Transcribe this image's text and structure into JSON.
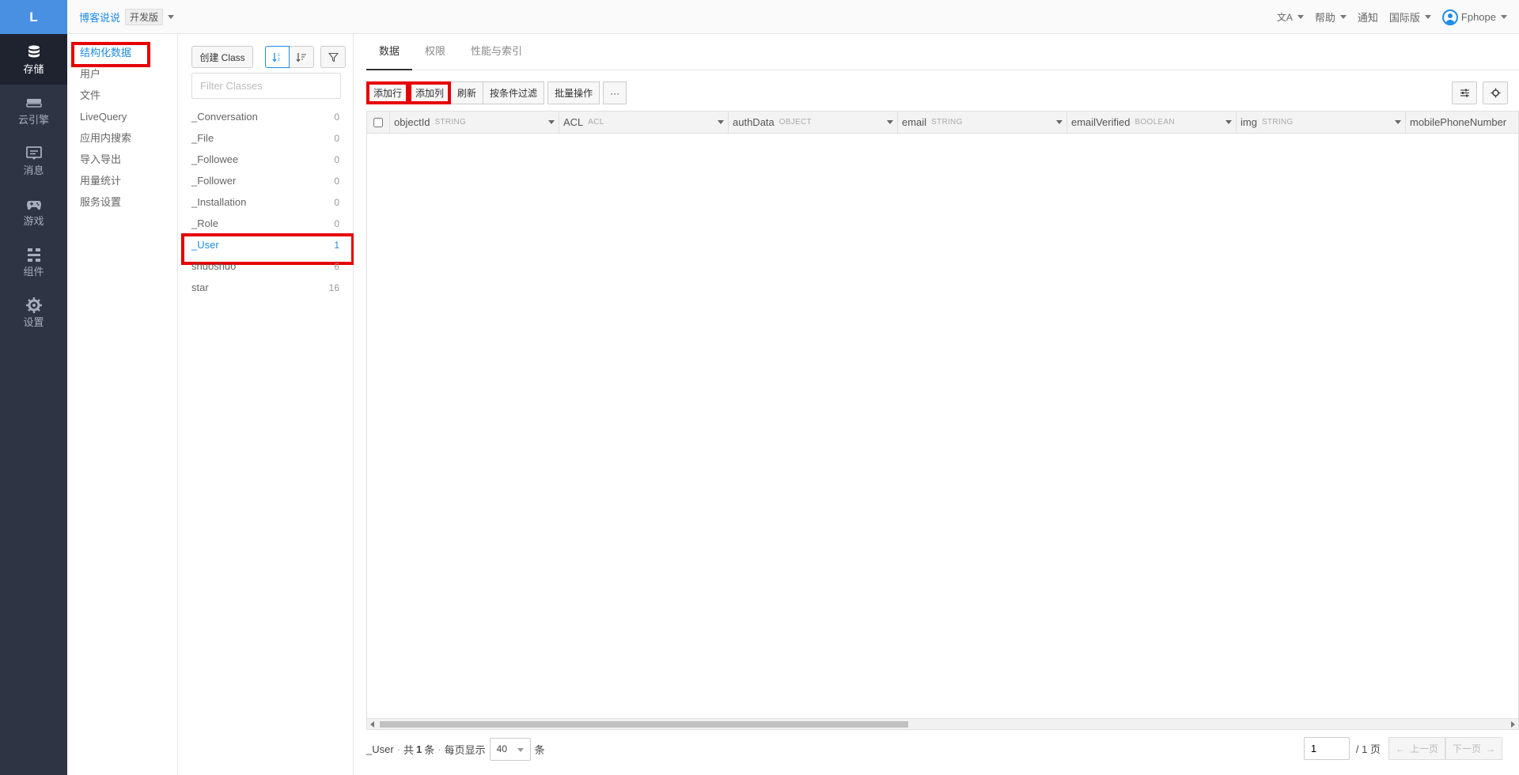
{
  "nav": {
    "logo": "L",
    "items": [
      {
        "label": "存储",
        "icon": "database-icon",
        "active": true
      },
      {
        "label": "云引擎",
        "icon": "server-icon",
        "active": false
      },
      {
        "label": "消息",
        "icon": "message-icon",
        "active": false
      },
      {
        "label": "游戏",
        "icon": "gamepad-icon",
        "active": false
      },
      {
        "label": "组件",
        "icon": "components-icon",
        "active": false
      },
      {
        "label": "设置",
        "icon": "gear-icon",
        "active": false
      }
    ]
  },
  "topbar": {
    "app_name": "博客说说",
    "env": "开发版",
    "translate_icon": "文A",
    "help": "帮助",
    "notify": "通知",
    "region": "国际版",
    "user": "Fphope"
  },
  "submenu": {
    "items": [
      "结构化数据",
      "用户",
      "文件",
      "LiveQuery",
      "应用内搜索",
      "导入导出",
      "用量统计",
      "服务设置"
    ]
  },
  "classes": {
    "create_label": "创建 Class",
    "filter_placeholder": "Filter Classes",
    "items": [
      {
        "name": "_Conversation",
        "count": "0"
      },
      {
        "name": "_File",
        "count": "0"
      },
      {
        "name": "_Followee",
        "count": "0"
      },
      {
        "name": "_Follower",
        "count": "0"
      },
      {
        "name": "_Installation",
        "count": "0"
      },
      {
        "name": "_Role",
        "count": "0"
      },
      {
        "name": "_User",
        "count": "1"
      },
      {
        "name": "shuoshuo",
        "count": "6"
      },
      {
        "name": "star",
        "count": "16"
      }
    ]
  },
  "tabs": [
    "数据",
    "权限",
    "性能与索引"
  ],
  "toolbar": {
    "add_row": "添加行",
    "add_col": "添加列",
    "refresh": "刷新",
    "filter": "按条件过滤",
    "batch": "批量操作",
    "more": "···"
  },
  "columns": [
    {
      "name": "objectId",
      "type": "STRING"
    },
    {
      "name": "ACL",
      "type": "ACL"
    },
    {
      "name": "authData",
      "type": "OBJECT"
    },
    {
      "name": "email",
      "type": "STRING"
    },
    {
      "name": "emailVerified",
      "type": "BOOLEAN"
    },
    {
      "name": "img",
      "type": "STRING"
    },
    {
      "name": "mobilePhoneNumber",
      "type": ""
    }
  ],
  "footer": {
    "class_name": "_User",
    "total_prefix": "共",
    "total": "1",
    "total_unit": "条",
    "per_page_label": "每页显示",
    "per_page": "40",
    "per_page_unit": "条",
    "page": "1",
    "total_pages": "/ 1 页",
    "prev": "上一页",
    "next": "下一页"
  }
}
